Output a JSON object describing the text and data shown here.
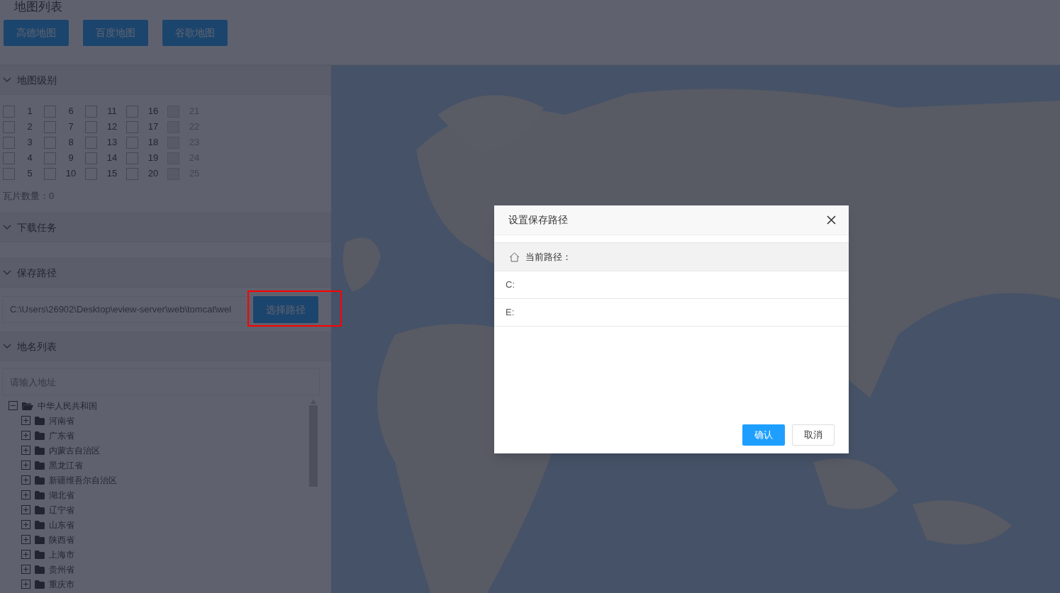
{
  "page_title": "地图列表",
  "map_sources": [
    {
      "label": "高德地图"
    },
    {
      "label": "百度地图"
    },
    {
      "label": "谷歌地图"
    }
  ],
  "sections": [
    {
      "kind": "levels",
      "title": "地图级别",
      "expanded": true,
      "levels": [
        {
          "label": "1",
          "checked": false,
          "disabled": false
        },
        {
          "label": "2",
          "checked": false,
          "disabled": false
        },
        {
          "label": "3",
          "checked": false,
          "disabled": false
        },
        {
          "label": "4",
          "checked": false,
          "disabled": false
        },
        {
          "label": "5",
          "checked": false,
          "disabled": false
        },
        {
          "label": "6",
          "checked": false,
          "disabled": false
        },
        {
          "label": "7",
          "checked": false,
          "disabled": false
        },
        {
          "label": "8",
          "checked": false,
          "disabled": false
        },
        {
          "label": "9",
          "checked": false,
          "disabled": false
        },
        {
          "label": "10",
          "checked": false,
          "disabled": false
        },
        {
          "label": "11",
          "checked": false,
          "disabled": false
        },
        {
          "label": "12",
          "checked": false,
          "disabled": false
        },
        {
          "label": "13",
          "checked": false,
          "disabled": false
        },
        {
          "label": "14",
          "checked": false,
          "disabled": false
        },
        {
          "label": "15",
          "checked": false,
          "disabled": false
        },
        {
          "label": "16",
          "checked": false,
          "disabled": false
        },
        {
          "label": "17",
          "checked": false,
          "disabled": false
        },
        {
          "label": "18",
          "checked": false,
          "disabled": false
        },
        {
          "label": "19",
          "checked": false,
          "disabled": false
        },
        {
          "label": "20",
          "checked": false,
          "disabled": false
        },
        {
          "label": "21",
          "checked": false,
          "disabled": true
        },
        {
          "label": "22",
          "checked": false,
          "disabled": true
        },
        {
          "label": "23",
          "checked": false,
          "disabled": true
        },
        {
          "label": "24",
          "checked": false,
          "disabled": true
        },
        {
          "label": "25",
          "checked": false,
          "disabled": true
        }
      ],
      "tile_count": "瓦片数量：0"
    },
    {
      "kind": "empty",
      "title": "下载任务",
      "expanded": true
    },
    {
      "kind": "path",
      "title": "保存路径",
      "expanded": true,
      "path": "C:\\Users\\26902\\Desktop\\eview-server\\web\\tomcat\\wel",
      "button": "选择路径",
      "highlighted": true
    },
    {
      "kind": "places",
      "title": "地名列表",
      "expanded": true,
      "search_placeholder": "请输入地址",
      "tree": [
        {
          "label": "中华人民共和国",
          "expanded": true,
          "children": [
            {
              "label": "河南省",
              "expanded": false
            },
            {
              "label": "广东省",
              "expanded": false
            },
            {
              "label": "内蒙古自治区",
              "expanded": false
            },
            {
              "label": "黑龙江省",
              "expanded": false
            },
            {
              "label": "新疆维吾尔自治区",
              "expanded": false
            },
            {
              "label": "湖北省",
              "expanded": false
            },
            {
              "label": "辽宁省",
              "expanded": false
            },
            {
              "label": "山东省",
              "expanded": false
            },
            {
              "label": "陕西省",
              "expanded": false
            },
            {
              "label": "上海市",
              "expanded": false
            },
            {
              "label": "贵州省",
              "expanded": false
            },
            {
              "label": "重庆市",
              "expanded": false
            }
          ]
        }
      ]
    }
  ],
  "dialog": {
    "title": "设置保存路径",
    "current_path_label": "当前路径：",
    "drives": [
      {
        "label": "C:"
      },
      {
        "label": "E:"
      }
    ],
    "confirm": "确认",
    "cancel": "取消"
  }
}
